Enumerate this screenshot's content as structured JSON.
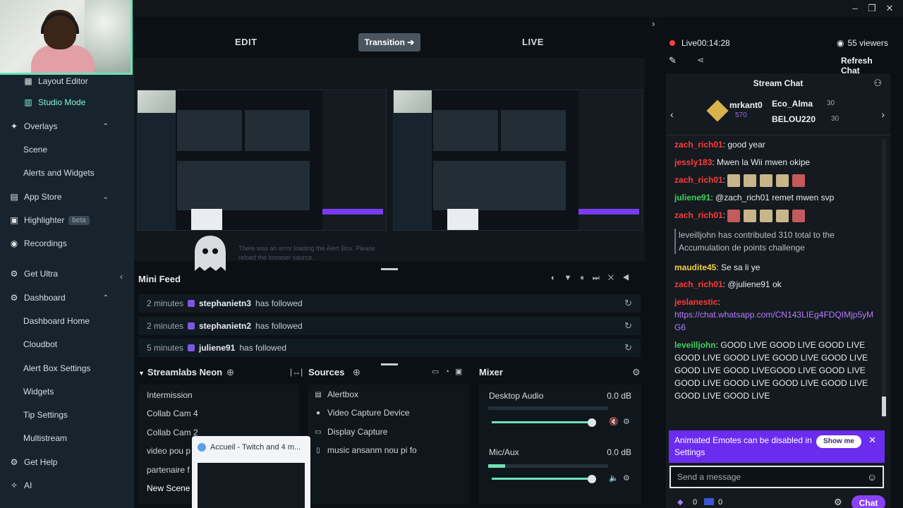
{
  "editor": {
    "edit_label": "EDIT",
    "transition_label": "Transition ➔",
    "live_label": "LIVE",
    "alert_error": "There was an error loading the Alert Box. Please reload the browser source."
  },
  "sidebar": {
    "items": [
      {
        "label": "Layout Editor",
        "icon": "layout-icon"
      },
      {
        "label": "Studio Mode",
        "icon": "studio-mode-icon"
      },
      {
        "label": "Overlays",
        "icon": "overlays-icon"
      },
      {
        "label": "Scene"
      },
      {
        "label": "Alerts and Widgets"
      },
      {
        "label": "App Store",
        "icon": "store-icon"
      },
      {
        "label": "Highlighter",
        "icon": "highlighter-icon",
        "badge": "beta"
      },
      {
        "label": "Recordings",
        "icon": "recordings-icon"
      },
      {
        "label": "Get Ultra",
        "icon": "ultra-icon"
      },
      {
        "label": "Dashboard",
        "icon": "dashboard-icon"
      },
      {
        "label": "Dashboard Home"
      },
      {
        "label": "Cloudbot"
      },
      {
        "label": "Alert Box Settings"
      },
      {
        "label": "Widgets"
      },
      {
        "label": "Tip Settings"
      },
      {
        "label": "Multistream"
      },
      {
        "label": "Get Help",
        "icon": "help-icon"
      },
      {
        "label": "AI",
        "icon": "ai-icon"
      }
    ]
  },
  "minifeed": {
    "title": "Mini Feed",
    "rows": [
      {
        "time": "2 minutes",
        "user": "stephanietn3",
        "action": "has followed"
      },
      {
        "time": "2 minutes",
        "user": "stephanietn2",
        "action": "has followed"
      },
      {
        "time": "5 minutes",
        "user": "juliene91",
        "action": "has followed"
      }
    ]
  },
  "scenes": {
    "title": "Streamlabs Neon",
    "items": [
      "Intermission",
      "Collab Cam 4",
      "Collab Cam 2",
      "video pou p",
      "partenaire f",
      "New Scene"
    ]
  },
  "sources": {
    "title": "Sources",
    "items": [
      {
        "label": "Alertbox",
        "icon": "alertbox-icon"
      },
      {
        "label": "Video Capture Device",
        "icon": "camera-icon"
      },
      {
        "label": "Display Capture",
        "icon": "monitor-icon"
      },
      {
        "label": "music ansanm nou pi fo",
        "icon": "music-file-icon"
      }
    ]
  },
  "mixer": {
    "title": "Mixer",
    "channels": [
      {
        "label": "Desktop Audio",
        "db": "0.0 dB",
        "level": 0.0,
        "volume": 0.95
      },
      {
        "label": "Mic/Aux",
        "db": "0.0 dB",
        "level": 0.15,
        "volume": 0.95
      }
    ]
  },
  "popup": {
    "title": "Accueil - Twitch and 4 m..."
  },
  "chat": {
    "live_time": "Live00:14:28",
    "viewers": "55 viewers",
    "refresh": "Refresh Chat",
    "title": "Stream Chat",
    "leaderboard": {
      "first": {
        "name": "mrkant0",
        "points": "570"
      },
      "second": {
        "name": "Eco_Alma",
        "points": "30"
      },
      "third": {
        "name": "BELOU220",
        "points": "30"
      }
    },
    "messages": [
      {
        "name": "zach_rich01",
        "color": "#ff3b3b",
        "text": ": good year"
      },
      {
        "name": "jessly183",
        "color": "#ff3b3b",
        "text": ": Mwen la Wii mwen okipe"
      },
      {
        "name": "zach_rich01",
        "color": "#ff3b3b",
        "text": ":"
      },
      {
        "name": "juliene91",
        "color": "#3fd45a",
        "text": ": @zach_rich01 remet mwen svp"
      },
      {
        "name": "zach_rich01",
        "color": "#ff3b3b",
        "text": ":"
      },
      {
        "name": "",
        "color": "#b8bfc5",
        "text": "leveilljohn has contributed 310 total to the Accumulation de points challenge"
      },
      {
        "name": "maudite45",
        "color": "#f4d03f",
        "text": ": Se sa li ye"
      },
      {
        "name": "zach_rich01",
        "color": "#ff3b3b",
        "text": ": @juliene91 ok"
      },
      {
        "name": "jeslanestic",
        "color": "#ff3b3b",
        "text": ":"
      },
      {
        "name": "",
        "color": "#b57bff",
        "text": "https://chat.whatsapp.com/CN143LIEg4FDQIMjp5yMG6"
      },
      {
        "name": "leveilljohn",
        "color": "#3fd45a",
        "text": ": GOOD LIVE GOOD LIVE GOOD LIVE GOOD LIVE GOOD LIVE GOOD LIVE GOOD LIVE GOOD LIVE GOOD LIVEGOOD LIVE GOOD LIVE GOOD LIVE GOOD LIVE GOOD LIVE GOOD LIVE GOOD LIVE GOOD LIVE"
      }
    ],
    "banner_text": "Animated Emotes can be disabled in Settings",
    "banner_button": "Show me",
    "input_placeholder": "Send a message",
    "send_label": "Chat",
    "points_a": "0",
    "points_b": "0"
  }
}
